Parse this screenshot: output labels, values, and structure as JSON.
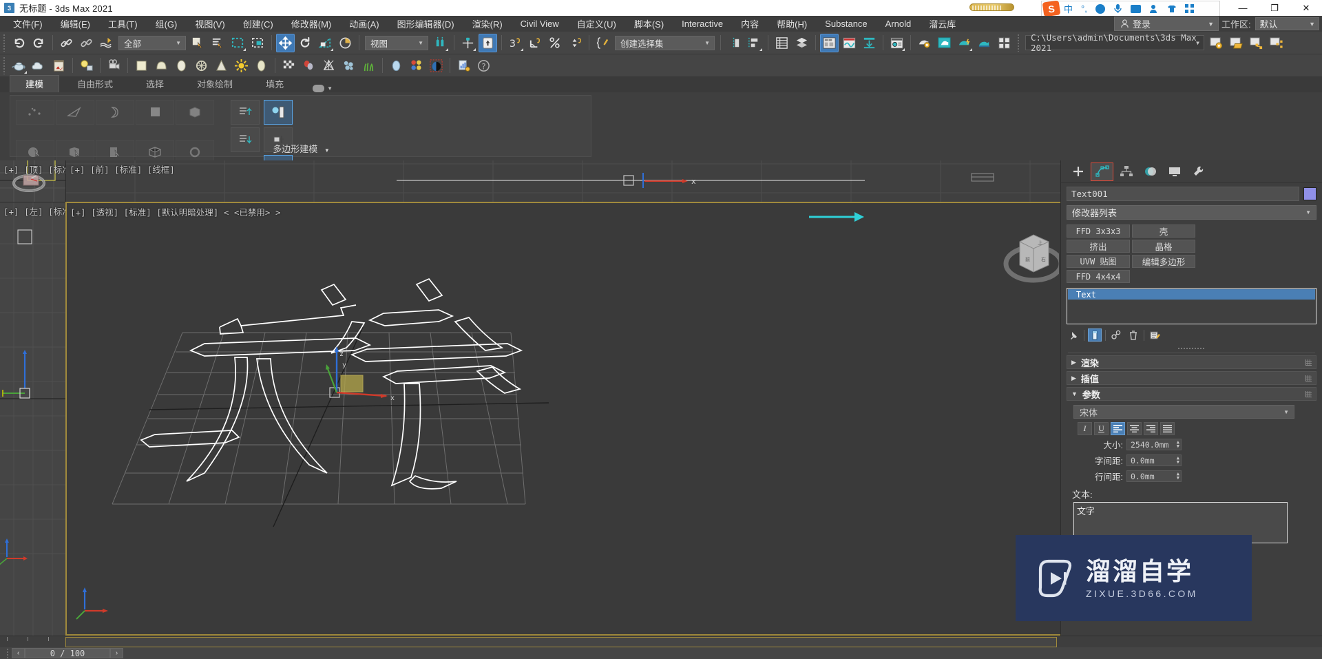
{
  "window": {
    "title": "无标题 - 3ds Max 2021",
    "app_icon": "3",
    "minimize": "—",
    "maximize": "❐",
    "close": "✕"
  },
  "ime": {
    "logo": "S",
    "mode": "中",
    "punct": "°,",
    "emoji": "smiley-icon",
    "mic": "mic-icon",
    "keyboard": "keyboard-icon",
    "user": "user-icon",
    "skin": "skin-icon",
    "apps": "apps-icon"
  },
  "menubar": {
    "items": [
      "文件(F)",
      "编辑(E)",
      "工具(T)",
      "组(G)",
      "视图(V)",
      "创建(C)",
      "修改器(M)",
      "动画(A)",
      "图形编辑器(D)",
      "渲染(R)",
      "Civil View",
      "自定义(U)",
      "脚本(S)",
      "Interactive",
      "内容",
      "帮助(H)",
      "Substance",
      "Arnold",
      "溜云库"
    ],
    "login_label": "登录",
    "workspace_label": "工作区:",
    "workspace_value": "默认"
  },
  "toolbar": {
    "selection_filter": "全部",
    "ref_coord_system": "视图",
    "named_selection_sets": "创建选择集",
    "project_path": "C:\\Users\\admin\\Documents\\3ds Max 2021",
    "row1_icons": [
      "undo-icon",
      "redo-icon",
      "select-link-icon",
      "unlink-icon",
      "bind-space-warp-icon",
      "select-object-icon",
      "select-by-name-icon",
      "rectangular-region-icon",
      "window-crossing-icon",
      "select-move-icon",
      "select-rotate-icon",
      "select-scale-icon",
      "placement-icon",
      "pivot-snap-icon",
      "use-center-icon",
      "snaps-toggle-icon",
      "angle-snap-icon",
      "percent-snap-icon",
      "spinner-snap-icon",
      "edit-named-sets-icon",
      "mirror-icon",
      "align-icon",
      "layer-explorer-icon",
      "scene-explorer-icon",
      "curve-editor-icon",
      "schematic-view-icon",
      "material-editor-icon",
      "render-setup-icon",
      "render-frame-icon",
      "render-production-icon",
      "render-iterative-icon",
      "render-in-cloud-icon",
      "open-asset-tracking-icon",
      "project-folder-icon",
      "open-folder-icon",
      "node-icon",
      "node-link-icon"
    ],
    "row2_icons": [
      "teapot-icon",
      "cloud-icon",
      "poster-icon",
      "light-icon",
      "camera-icon",
      "box-icon",
      "sphere-icon",
      "cylinder-icon",
      "torus-icon",
      "cone-icon",
      "sun-icon",
      "capsule-icon",
      "checker-icon",
      "atmospheric-icon",
      "space-warp-icon",
      "particle-icon",
      "hair-icon",
      "drop-icon",
      "rgb-icon",
      "helper-icon",
      "report-icon",
      "help-icon"
    ]
  },
  "ribbon": {
    "tabs": [
      "建模",
      "自由形式",
      "选择",
      "对象绘制",
      "填充"
    ],
    "active_tab": "建模",
    "panel_label": "多边形建模",
    "minimize_icon": "ribbon-minimize-icon"
  },
  "viewports": [
    {
      "name": "top",
      "label": "[+] [顶] [标准]"
    },
    {
      "name": "front",
      "label": "[+] [前] [标准] [线框]"
    },
    {
      "name": "left",
      "label": "[+] [左] [标准]"
    },
    {
      "name": "persp",
      "label": "[+] [透视] [标准] [默认明暗处理]  < <已禁用> >"
    }
  ],
  "command_panel": {
    "tabs": [
      "create-tab",
      "modify-tab",
      "hierarchy-tab",
      "motion-tab",
      "display-tab",
      "utilities-tab"
    ],
    "active_tab_index": 1,
    "object_name": "Text001",
    "object_color": "#9090e8",
    "modifier_list_label": "修改器列表",
    "modifier_buttons": [
      "FFD 3x3x3",
      "壳",
      "挤出",
      "晶格",
      "UVW 贴图",
      "编辑多边形",
      "FFD 4x4x4"
    ],
    "stack_items": [
      "Text"
    ],
    "stack_tools": [
      "pin-stack-icon",
      "show-end-result-icon",
      "make-unique-icon",
      "remove-modifier-icon",
      "configure-sets-icon"
    ],
    "rollouts": [
      {
        "title": "渲染",
        "open": false
      },
      {
        "title": "插值",
        "open": false
      },
      {
        "title": "参数",
        "open": true
      }
    ],
    "parameters": {
      "font": "宋体",
      "style_buttons": [
        "I",
        "U"
      ],
      "align_buttons": [
        "align-left-icon",
        "align-center-icon",
        "align-right-icon",
        "align-justify-icon"
      ],
      "active_align_index": 0,
      "size_label": "大小:",
      "size_value": "2540.0mm",
      "kerning_label": "字间距:",
      "kerning_value": "0.0mm",
      "leading_label": "行间距:",
      "leading_value": "0.0mm",
      "text_label": "文本:",
      "text_value": "文字"
    }
  },
  "timeline": {
    "frame_field": "0 / 100",
    "prev_label": "‹",
    "next_label": "›"
  },
  "watermark": {
    "cn_text": "溜溜自学",
    "en_text": "ZIXUE.3D66.COM",
    "logo": "play-logo-icon",
    "bg_color": "#28375e"
  },
  "colors": {
    "accent_blue": "#4a7fb5",
    "panel_bg": "#454545",
    "viewport_bg": "#3a3a3a",
    "active_vp_border": "#a08a3c",
    "teal": "#2fb8c0",
    "orange": "#e04a3a"
  }
}
